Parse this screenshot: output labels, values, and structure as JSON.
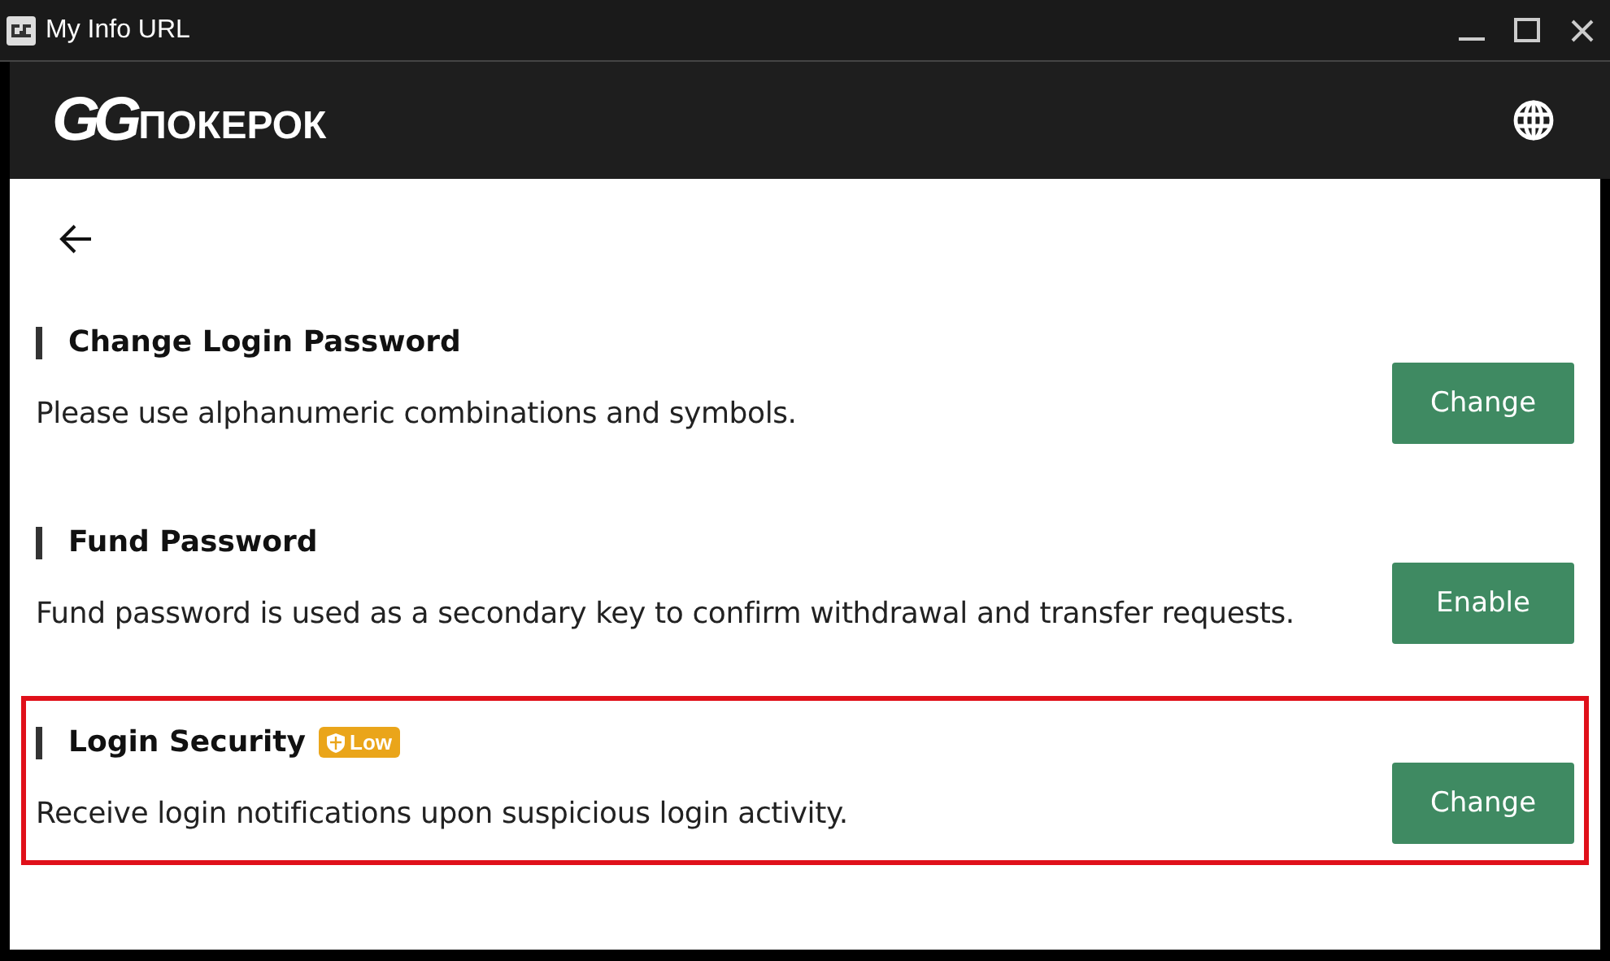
{
  "window": {
    "title": "My Info URL"
  },
  "header": {
    "logo_mark": "GG",
    "logo_text": "ПОКЕРОК"
  },
  "sections": [
    {
      "title": "Change Login Password",
      "description": "Please use alphanumeric combinations and symbols.",
      "button": "Change",
      "highlighted": false
    },
    {
      "title": "Fund Password",
      "description": "Fund password is used as a secondary key to confirm withdrawal and transfer requests.",
      "button": "Enable",
      "highlighted": false
    },
    {
      "title": "Login Security",
      "badge": "Low",
      "description": "Receive login notifications upon suspicious login activity.",
      "button": "Change",
      "highlighted": true
    }
  ]
}
